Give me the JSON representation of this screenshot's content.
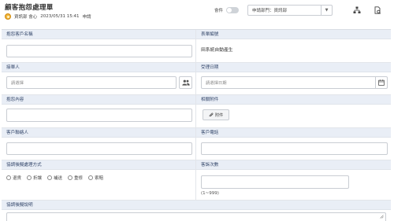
{
  "header": {
    "title": "顧客抱怨處理單",
    "user": "資訊部 會心",
    "datetime": "2023/05/31 15:41",
    "status": "申請",
    "toggle_label": "會件",
    "dept_select": "申請部門：資訊部"
  },
  "icons": {
    "org_chart": "org-chart-icon",
    "document": "document-settings-icon",
    "contact": "contacts-icon",
    "calendar": "calendar-icon",
    "attach": "paperclip-icon",
    "resize": "resize-handle-icon"
  },
  "form": {
    "customer_name": {
      "label": "抱怨客戶名稱",
      "value": ""
    },
    "form_number": {
      "label": "表單編號",
      "value": "田系統自動產生"
    },
    "receiver": {
      "label": "接單人",
      "placeholder": "請選擇"
    },
    "receive_date": {
      "label": "受理日期",
      "placeholder": "請選擇日期"
    },
    "complaint_content": {
      "label": "抱怨內容",
      "value": ""
    },
    "attachments": {
      "label": "相關附件",
      "button": "附件"
    },
    "contact_person": {
      "label": "客戶聯絡人",
      "value": ""
    },
    "phone": {
      "label": "客戶電話",
      "value": ""
    },
    "negotiation_method": {
      "label": "協調後擬處理方式",
      "options": [
        "退貨",
        "折讓",
        "補送",
        "重修",
        "索賠"
      ]
    },
    "complaint_count": {
      "label": "客訴次數",
      "value": "",
      "hint": "(1~999)"
    },
    "negotiation_notes": {
      "label": "協調後擬說明"
    }
  },
  "colors": {
    "label_bg": "#e9eef6",
    "label_text": "#33466a",
    "border": "#c9cdd3",
    "avatar": "#f0b43a"
  }
}
